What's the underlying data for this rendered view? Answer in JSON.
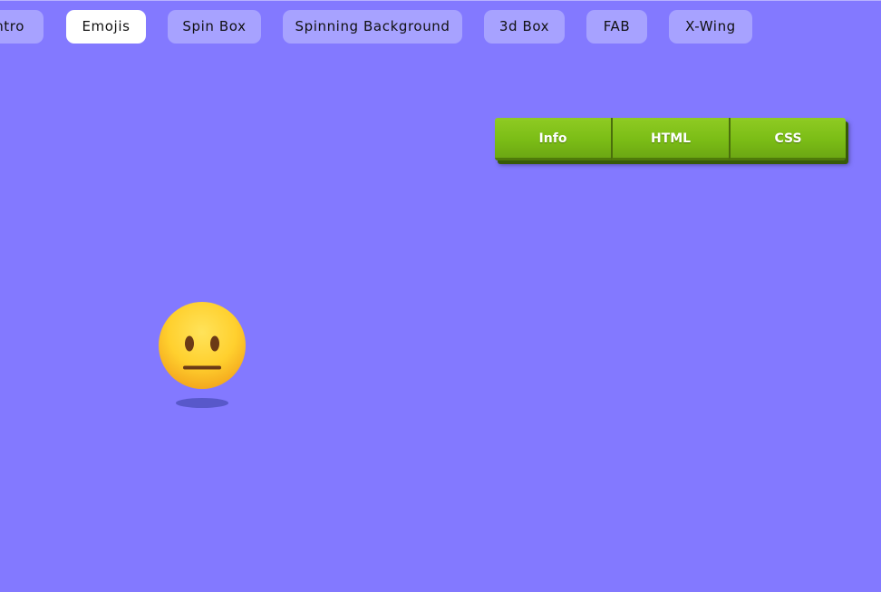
{
  "tabs": [
    {
      "label": "ntro",
      "active": false
    },
    {
      "label": "Emojis",
      "active": true
    },
    {
      "label": "Spin Box",
      "active": false
    },
    {
      "label": "Spinning Background",
      "active": false
    },
    {
      "label": "3d Box",
      "active": false
    },
    {
      "label": "FAB",
      "active": false
    },
    {
      "label": "X-Wing",
      "active": false
    }
  ],
  "button_group": {
    "info_label": "Info",
    "html_label": "HTML",
    "css_label": "CSS"
  },
  "emoji": {
    "icon": "neutral-face-icon"
  },
  "colors": {
    "background": "#8379ff",
    "tab": "#a7a2ff",
    "tab_active": "#ffffff",
    "button_green": "#7bbd16",
    "emoji_yellow": "#ffd43a"
  }
}
